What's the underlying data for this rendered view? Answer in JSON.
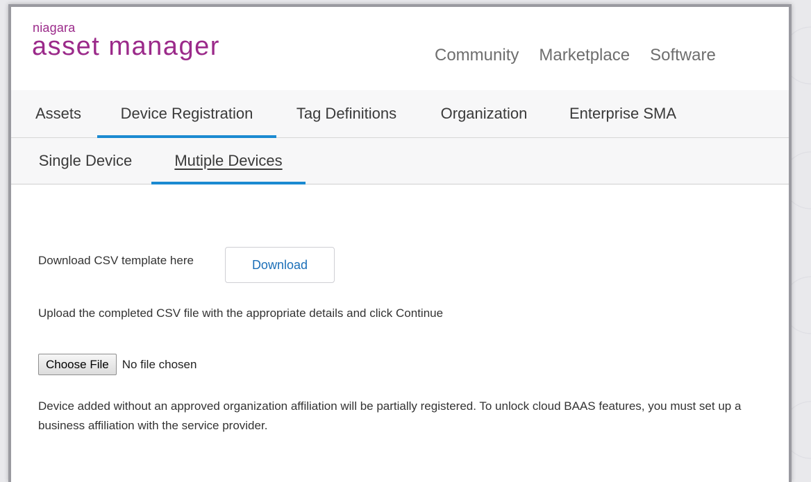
{
  "brand": {
    "small": "niagara",
    "main": "asset manager",
    "color": "#9b2a8a"
  },
  "topnav": {
    "items": [
      "Community",
      "Marketplace",
      "Software"
    ]
  },
  "primary_tabs": {
    "items": [
      "Assets",
      "Device Registration",
      "Tag Definitions",
      "Organization",
      "Enterprise SMA"
    ],
    "active": "Device Registration",
    "accent": "#1b8ad1"
  },
  "secondary_tabs": {
    "items": [
      "Single Device",
      "Mutiple Devices"
    ],
    "active": "Mutiple Devices"
  },
  "content": {
    "download_label": "Download CSV template here",
    "download_button": "Download",
    "upload_instruction": "Upload the completed CSV file with the appropriate details and click Continue",
    "choose_file_button": "Choose File",
    "file_status": "No file chosen",
    "notice": "Device added without an approved organization affiliation will be partially registered. To unlock cloud BAAS features, you must set up a business affiliation with the service provider."
  }
}
